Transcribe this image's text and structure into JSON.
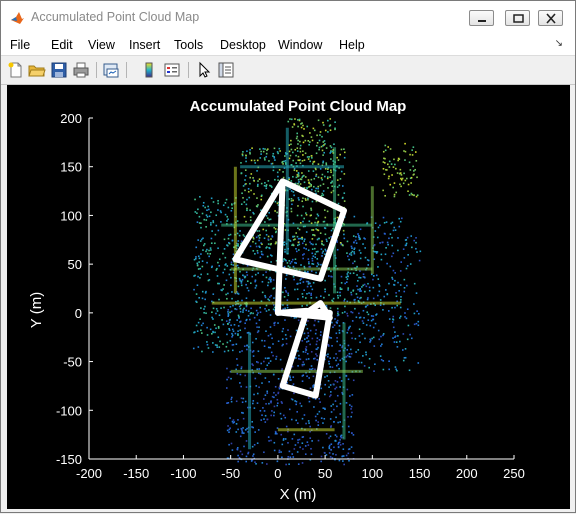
{
  "window": {
    "title": "Accumulated Point Cloud Map"
  },
  "menu": [
    "File",
    "Edit",
    "View",
    "Insert",
    "Tools",
    "Desktop",
    "Window",
    "Help"
  ],
  "toolbar_icons": [
    "new-figure-icon",
    "open-folder-icon",
    "save-icon",
    "print-icon",
    "link-plot-icon",
    "insert-colorbar-icon",
    "insert-legend-icon",
    "edit-plot-arrow-icon",
    "property-inspector-icon"
  ],
  "colors": {
    "background": "#000000",
    "trajectory": "#ffffff",
    "cloud_low": "#3b2a8c",
    "cloud_mid": "#1fa2c7",
    "cloud_high": "#e8e01f"
  },
  "chart_data": {
    "type": "scatter",
    "title": "Accumulated Point Cloud Map",
    "xlabel": "X (m)",
    "ylabel": "Y (m)",
    "xlim": [
      -200,
      250
    ],
    "ylim": [
      -150,
      200
    ],
    "xticks": [
      -200,
      -150,
      -100,
      -50,
      0,
      50,
      100,
      150,
      200,
      250
    ],
    "yticks": [
      200,
      150,
      100,
      50,
      0,
      -50,
      -100,
      -150
    ],
    "grid": false,
    "colormap": "parula",
    "trajectory": {
      "x": [
        5,
        -45,
        45,
        70,
        5,
        0,
        30,
        55,
        40,
        5,
        30,
        45,
        55,
        5
      ],
      "y": [
        135,
        55,
        35,
        105,
        135,
        0,
        2,
        0,
        -85,
        -75,
        0,
        10,
        -5,
        0
      ]
    }
  }
}
